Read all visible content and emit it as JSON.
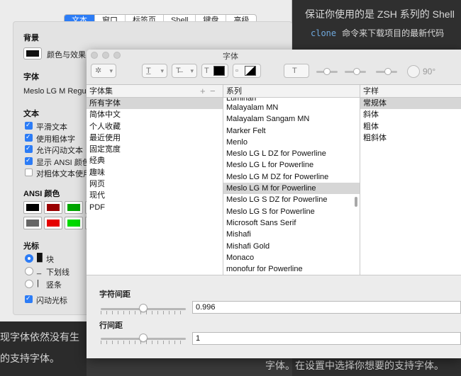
{
  "article": {
    "line1": "保证你使用的是 ZSH 系列的 Shell",
    "line2_code": "clone",
    "line2_text": "命令来下载项目的最新代码",
    "line3": "字体。在设置中选择你想要的支持字体。",
    "left_line1": "现字体依然没有生",
    "left_line2": "的支持字体。"
  },
  "prefs": {
    "tabs": [
      "文本",
      "窗口",
      "标签页",
      "Shell",
      "键盘",
      "高级"
    ],
    "active_tab": "文本",
    "background_head": "背景",
    "color_effects": "颜色与效果",
    "font_head": "字体",
    "font_value": "Meslo LG M Regula",
    "text_head": "文本",
    "text_options": [
      {
        "label": "平滑文本",
        "checked": true
      },
      {
        "label": "使用粗体字",
        "checked": true
      },
      {
        "label": "允许闪动文本",
        "checked": true
      },
      {
        "label": "显示 ANSI 颜色",
        "checked": true
      },
      {
        "label": "对粗体文本使用亮",
        "checked": false
      }
    ],
    "ansi_head": "ANSI 颜色",
    "ansi_colors": [
      "#000000",
      "#990000",
      "#00a600",
      "#999900",
      "#666666",
      "#e50000",
      "#00d900",
      "#e5e500"
    ],
    "cursor_head": "光标",
    "cursor_options": [
      {
        "label": "块",
        "glyph": "█",
        "selected": true
      },
      {
        "label": "下划线",
        "glyph": "_",
        "selected": false
      },
      {
        "label": "竖条",
        "glyph": "|",
        "selected": false
      }
    ],
    "blink_cursor": "闪动光标"
  },
  "fontpanel": {
    "title": "字体",
    "toolbar": {
      "text_color": "#000000",
      "degree": "90°"
    },
    "columns": {
      "collections": "字体集",
      "family": "系列",
      "typeface": "字样"
    },
    "collections": [
      "所有字体",
      "简体中文",
      "个人收藏",
      "最近使用",
      "固定宽度",
      "经典",
      "趣味",
      "网页",
      "现代",
      "PDF"
    ],
    "selected_collection": "所有字体",
    "families_cut_top": "Luminari",
    "families": [
      "Malayalam MN",
      "Malayalam Sangam MN",
      "Marker Felt",
      "Menlo",
      "Meslo LG L DZ for Powerline",
      "Meslo LG L for Powerline",
      "Meslo LG M DZ for Powerline",
      "Meslo LG M for Powerline",
      "Meslo LG S DZ for Powerline",
      "Meslo LG S for Powerline",
      "Microsoft Sans Serif",
      "Mishafi",
      "Mishafi Gold",
      "Monaco",
      "monofur for Powerline"
    ],
    "selected_family": "Meslo LG M for Powerline",
    "typefaces": [
      "常规体",
      "斜体",
      "粗体",
      "粗斜体"
    ],
    "selected_typeface": "常规体",
    "char_spacing_label": "字符间距",
    "char_spacing_value": "0.996",
    "char_spacing_fraction": 0.5,
    "line_spacing_label": "行间距",
    "line_spacing_value": "1",
    "line_spacing_fraction": 0.5
  }
}
